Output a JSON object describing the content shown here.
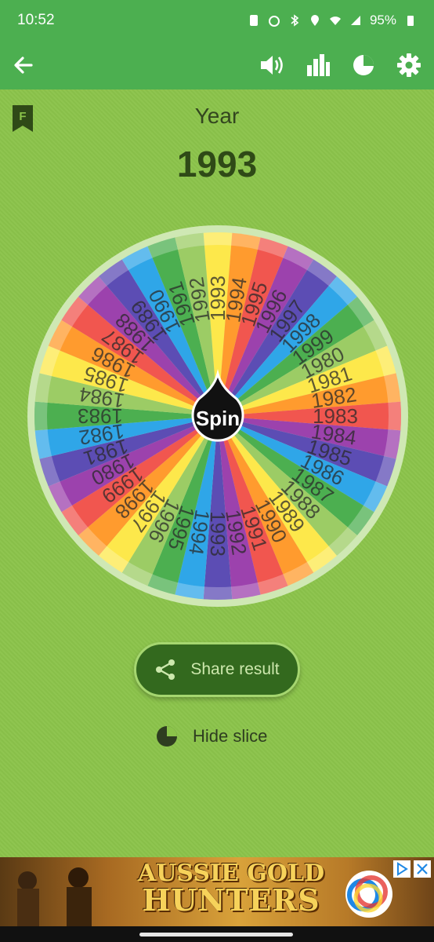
{
  "status": {
    "time": "10:52",
    "battery": "95%"
  },
  "app_bar": {
    "back_icon": "arrow-left-icon",
    "actions": [
      "volume-icon",
      "stats-icon",
      "pie-icon",
      "gear-icon"
    ]
  },
  "bookmark": {
    "letter": "F"
  },
  "title": "Year",
  "result": "1993",
  "wheel": {
    "spin_label": "Spin",
    "slices": [
      "1993",
      "1994",
      "1995",
      "1996",
      "1997",
      "1998",
      "1999",
      "1980",
      "1981",
      "1982",
      "1983",
      "1984",
      "1985",
      "1986",
      "1987",
      "1988",
      "1989",
      "1990",
      "1991",
      "1992",
      "1993",
      "1994",
      "1995",
      "1996",
      "1997",
      "1998",
      "1999",
      "1980",
      "1981",
      "1982",
      "1983",
      "1984",
      "1985",
      "1986",
      "1987",
      "1988",
      "1989",
      "1990",
      "1991",
      "1992"
    ],
    "colors": [
      "#fde84b",
      "#ff9b2e",
      "#f1564f",
      "#9c42ad",
      "#5c4db4",
      "#2fa6e8",
      "#4caf50",
      "#9ccc65"
    ]
  },
  "share_button": {
    "label": "Share result"
  },
  "hide_slice": {
    "label": "Hide slice"
  },
  "ad": {
    "line1": "AUSSIE GOLD",
    "line2": "HUNTERS"
  }
}
